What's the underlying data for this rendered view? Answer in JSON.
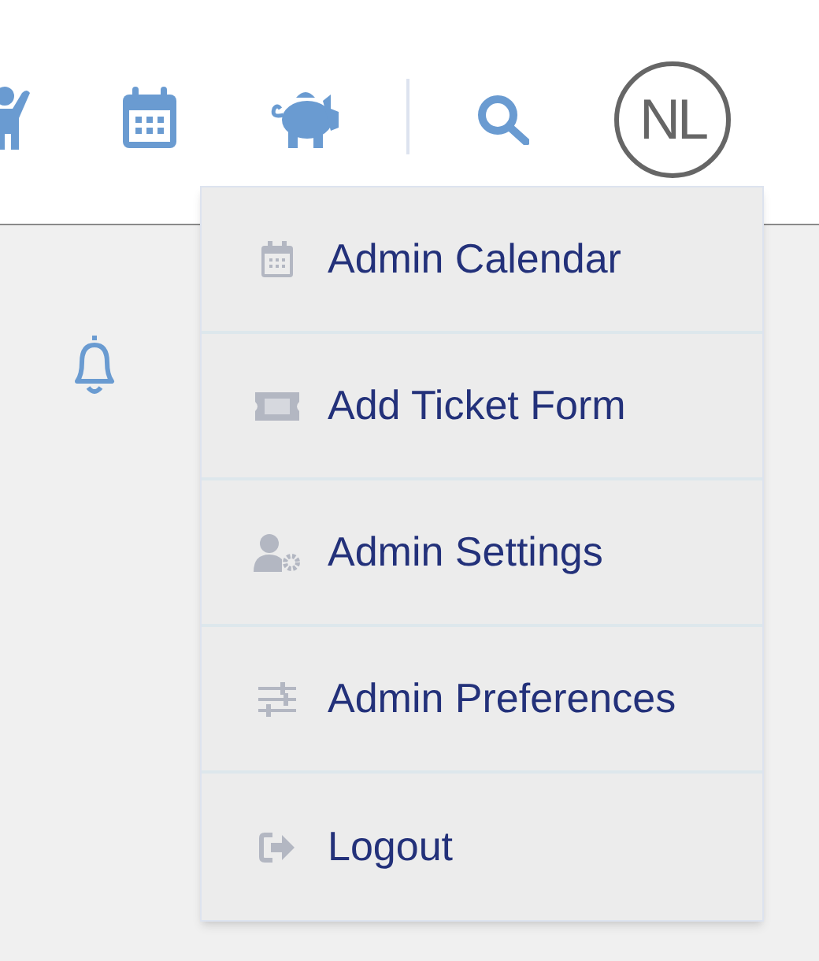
{
  "header": {
    "avatar": {
      "initials": "NL"
    }
  },
  "user_menu": {
    "items": [
      {
        "label": "Admin Calendar"
      },
      {
        "label": "Add Ticket Form"
      },
      {
        "label": "Admin Settings"
      },
      {
        "label": "Admin Preferences"
      },
      {
        "label": "Logout"
      }
    ]
  }
}
